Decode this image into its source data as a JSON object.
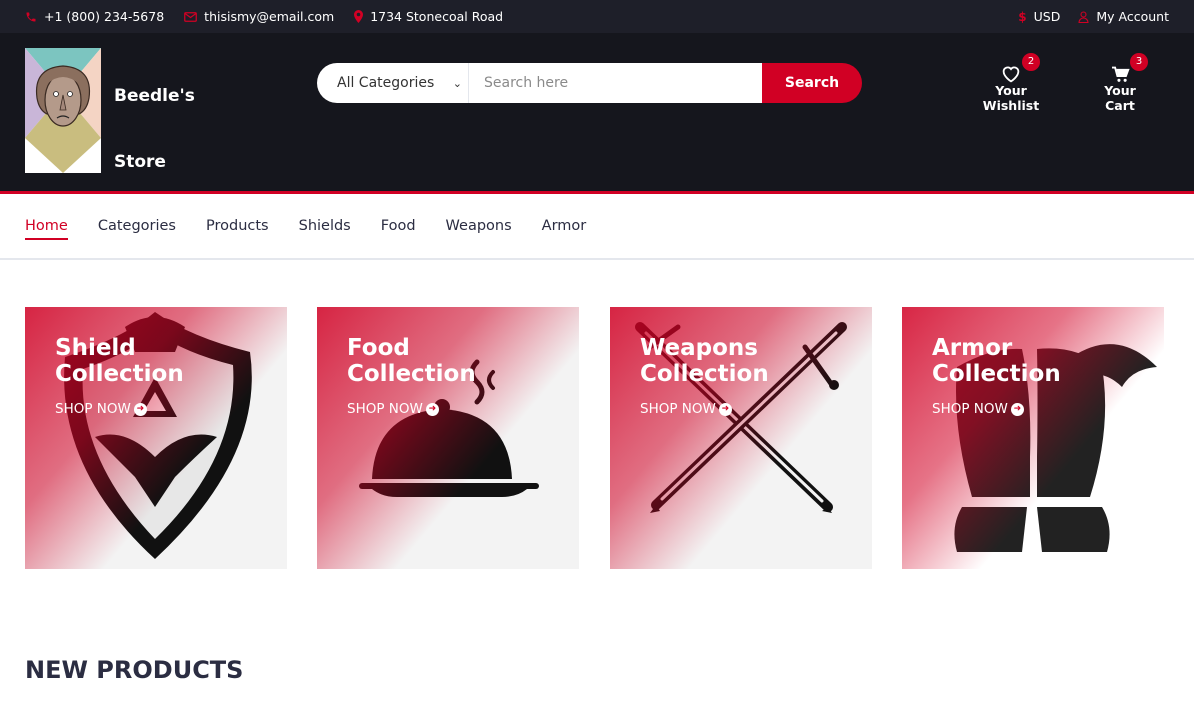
{
  "topbar": {
    "phone": "+1 (800) 234-5678",
    "email": "thisismy@email.com",
    "address": "1734 Stonecoal Road",
    "currency": "USD",
    "account": "My Account"
  },
  "header": {
    "store_name_line1": "Beedle's",
    "store_name_line2": "Store",
    "search": {
      "category": "All Categories",
      "placeholder": "Search here",
      "button": "Search"
    },
    "wishlist": {
      "label": "Your Wishlist",
      "count": "2"
    },
    "cart": {
      "label": "Your Cart",
      "count": "3"
    }
  },
  "nav": {
    "items": [
      {
        "label": "Home",
        "active": true
      },
      {
        "label": "Categories"
      },
      {
        "label": "Products"
      },
      {
        "label": "Shields"
      },
      {
        "label": "Food"
      },
      {
        "label": "Weapons"
      },
      {
        "label": "Armor"
      }
    ]
  },
  "collections": [
    {
      "title_1": "Shield",
      "title_2": "Collection",
      "link": "SHOP NOW",
      "icon": "shield-icon"
    },
    {
      "title_1": "Food",
      "title_2": "Collection",
      "link": "SHOP NOW",
      "icon": "cloche-icon"
    },
    {
      "title_1": "Weapons",
      "title_2": "Collection",
      "link": "SHOP NOW",
      "icon": "crossed-swords-icon"
    },
    {
      "title_1": "Armor",
      "title_2": "Collection",
      "link": "SHOP NOW",
      "icon": "armor-icon"
    }
  ],
  "sections": {
    "new_products": "NEW PRODUCTS"
  },
  "colors": {
    "accent": "#d10024",
    "dark": "#15161d",
    "topbar": "#1e1f29",
    "text": "#2b2d42"
  }
}
